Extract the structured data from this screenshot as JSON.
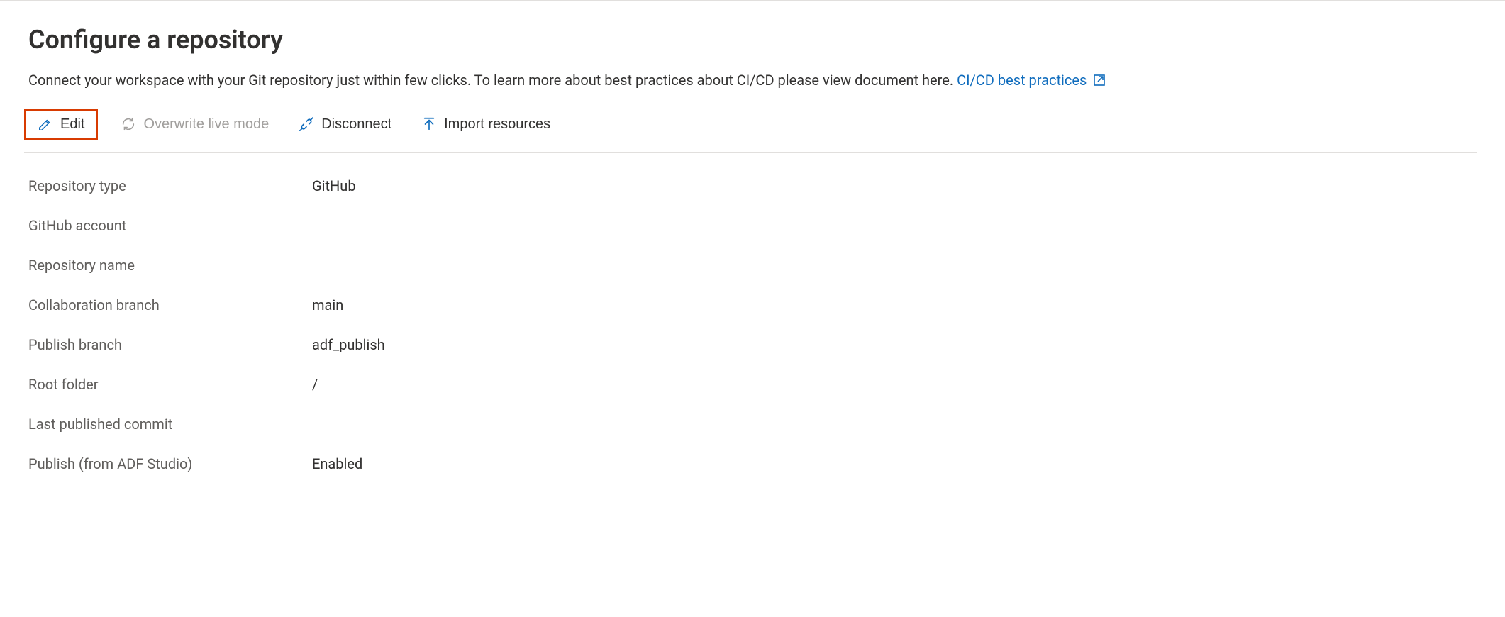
{
  "header": {
    "title": "Configure a repository",
    "subtitle_lead": "Connect your workspace with your Git repository just within few clicks. To learn more about best practices about CI/CD please view document here. ",
    "link_label": "CI/CD best practices"
  },
  "toolbar": {
    "edit_label": "Edit",
    "overwrite_label": "Overwrite live mode",
    "disconnect_label": "Disconnect",
    "import_label": "Import resources"
  },
  "fields": {
    "repository_type": {
      "label": "Repository type",
      "value": "GitHub"
    },
    "github_account": {
      "label": "GitHub account",
      "value": ""
    },
    "repository_name": {
      "label": "Repository name",
      "value": ""
    },
    "collab_branch": {
      "label": "Collaboration branch",
      "value": "main"
    },
    "publish_branch": {
      "label": "Publish branch",
      "value": "adf_publish"
    },
    "root_folder": {
      "label": "Root folder",
      "value": "/"
    },
    "last_commit": {
      "label": "Last published commit",
      "value": ""
    },
    "publish_adf": {
      "label": "Publish (from ADF Studio)",
      "value": "Enabled"
    }
  }
}
